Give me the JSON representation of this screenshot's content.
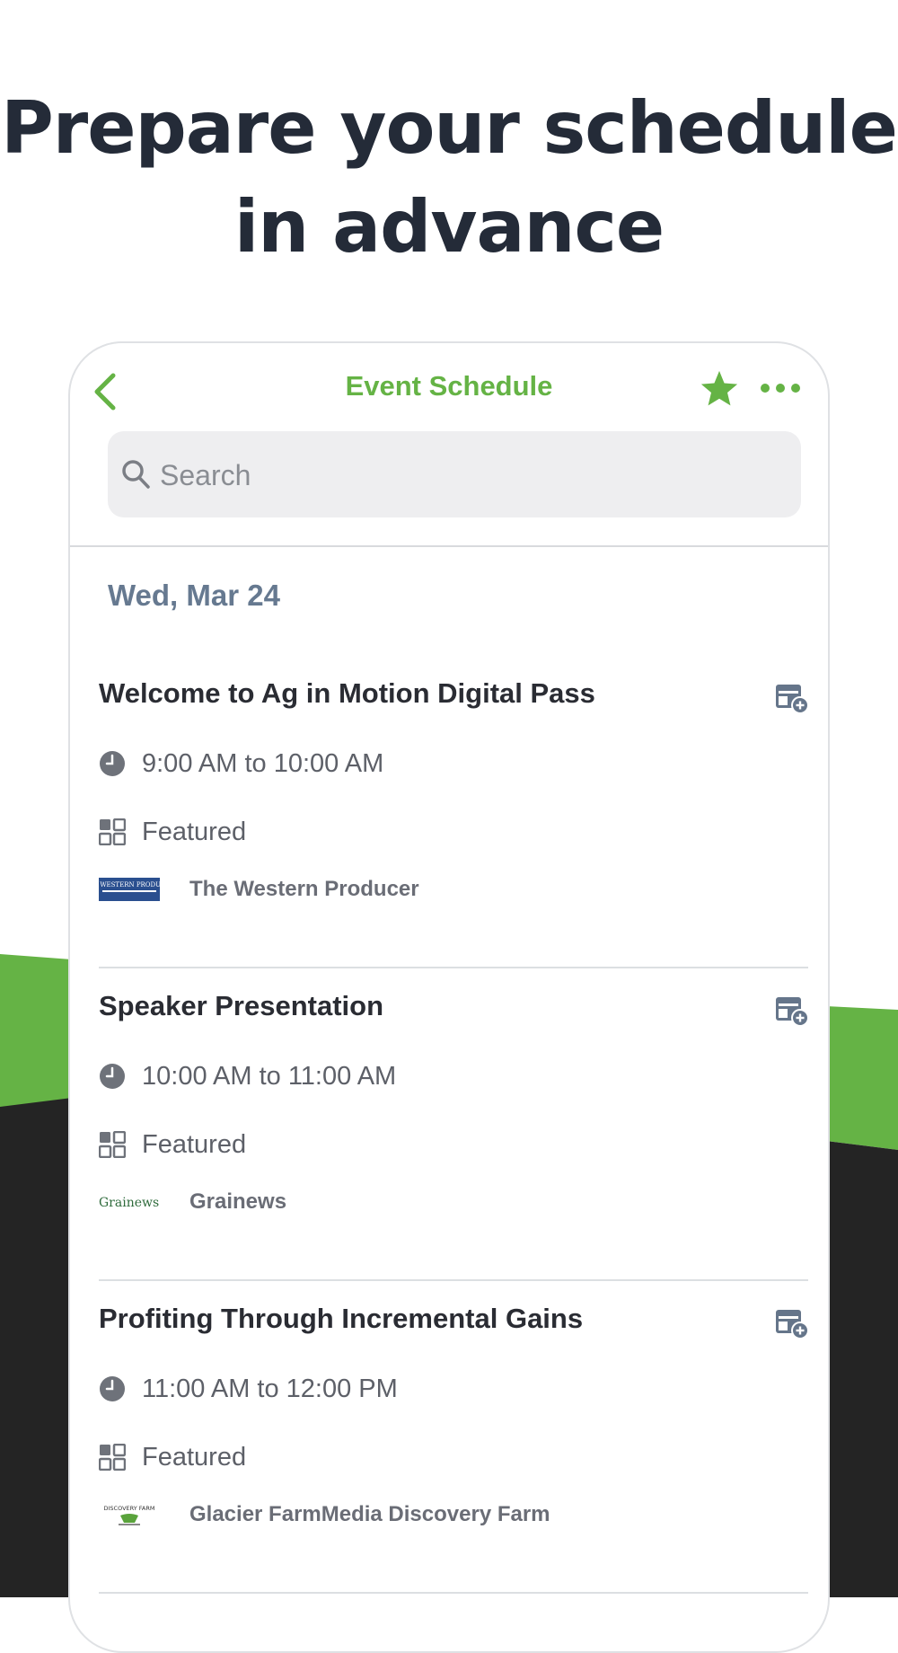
{
  "headline": "Prepare your schedule in advance",
  "colors": {
    "accent": "#65b345",
    "dark": "#242424",
    "date": "#667990"
  },
  "nav": {
    "title": "Event Schedule",
    "back_icon": "chevron-left-icon",
    "favorite_icon": "star-icon",
    "more_icon": "more-dots-icon"
  },
  "search": {
    "placeholder": "Search"
  },
  "date_heading": "Wed, Mar 24",
  "events": [
    {
      "title": "Welcome to Ag in Motion Digital Pass",
      "time": "9:00 AM to 10:00 AM",
      "category": "Featured",
      "sponsor": "The Western Producer",
      "logo_text": "THE WESTERN PRODUCER"
    },
    {
      "title": "Speaker Presentation",
      "time": "10:00 AM to 11:00 AM",
      "category": "Featured",
      "sponsor": "Grainews",
      "logo_text": "Grainews"
    },
    {
      "title": "Profiting Through Incremental Gains",
      "time": "11:00 AM to 12:00 PM",
      "category": "Featured",
      "sponsor": "Glacier FarmMedia Discovery Farm",
      "logo_text": "DISCOVERY FARM"
    }
  ]
}
